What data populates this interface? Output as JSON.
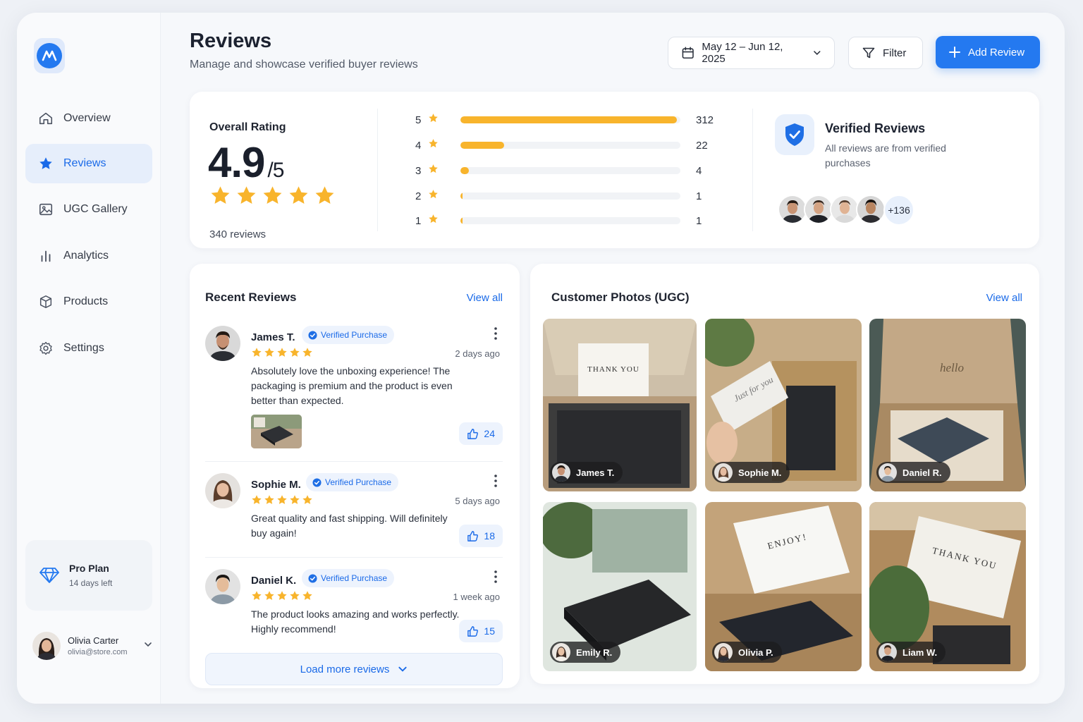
{
  "sidebar": {
    "items": [
      {
        "label": "Overview",
        "icon": "home-icon"
      },
      {
        "label": "Reviews",
        "icon": "star-icon",
        "active": true
      },
      {
        "label": "UGC Gallery",
        "icon": "image-icon"
      },
      {
        "label": "Analytics",
        "icon": "bar-chart-icon"
      },
      {
        "label": "Products",
        "icon": "box-icon"
      },
      {
        "label": "Settings",
        "icon": "gear-icon"
      }
    ],
    "plan": {
      "name": "Pro Plan",
      "days_left": "14 days left"
    },
    "user": {
      "name": "Olivia Carter",
      "email": "olivia@store.com"
    }
  },
  "header": {
    "title": "Reviews",
    "subtitle": "Manage and showcase verified buyer reviews",
    "date_range": "May 12 – Jun 12, 2025",
    "filter_label": "Filter",
    "add_label": "Add Review"
  },
  "rating": {
    "label": "Overall Rating",
    "value": "4.9",
    "out_of": "/5",
    "count_text": "340 reviews",
    "stars": 5,
    "distribution": [
      {
        "stars": "5",
        "count": "312",
        "fraction": 0.985
      },
      {
        "stars": "4",
        "count": "22",
        "fraction": 0.2
      },
      {
        "stars": "3",
        "count": "4",
        "fraction": 0.04
      },
      {
        "stars": "2",
        "count": "1",
        "fraction": 0.01
      },
      {
        "stars": "1",
        "count": "1",
        "fraction": 0.01
      }
    ]
  },
  "verified": {
    "title": "Verified Reviews",
    "subtitle": "All reviews are from verified purchases",
    "more_count": "+136"
  },
  "recent": {
    "title": "Recent Reviews",
    "view_all": "View all",
    "badge": "Verified Purchase",
    "load_more": "Load more reviews",
    "reviews": [
      {
        "name": "James T.",
        "time": "2 days ago",
        "text": "Absolutely love the unboxing experience! The packaging is premium and the product is even better than expected.",
        "likes": "24",
        "rating": 5
      },
      {
        "name": "Sophie M.",
        "time": "5 days ago",
        "text": "Great quality and fast shipping. Will definitely buy again!",
        "likes": "18",
        "rating": 5
      },
      {
        "name": "Daniel K.",
        "time": "1 week ago",
        "text": "The product looks amazing and works perfectly. Highly recommend!",
        "likes": "15",
        "rating": 5
      }
    ]
  },
  "ugc": {
    "title": "Customer Photos (UGC)",
    "view_all": "View all",
    "photos": [
      {
        "author": "James T.",
        "card_text": "THANK YOU"
      },
      {
        "author": "Sophie M.",
        "card_text": "Just for you"
      },
      {
        "author": "Daniel R.",
        "card_text": "hello"
      },
      {
        "author": "Emily R.",
        "card_text": ""
      },
      {
        "author": "Olivia P.",
        "card_text": "ENJOY!"
      },
      {
        "author": "Liam W.",
        "card_text": "THANK YOU"
      }
    ]
  },
  "colors": {
    "accent": "#2479f0",
    "star": "#f8b42c"
  }
}
